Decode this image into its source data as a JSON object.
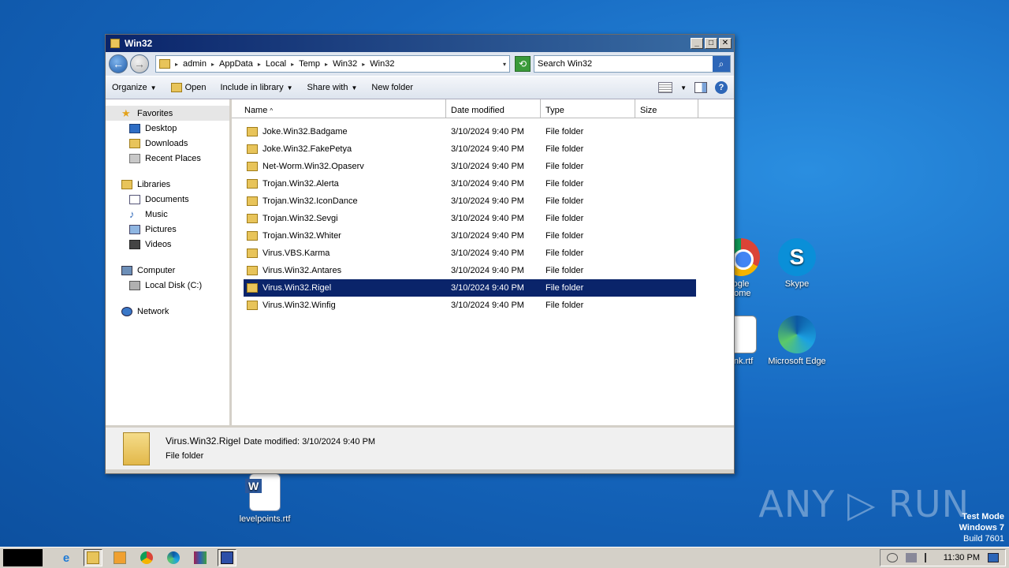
{
  "window": {
    "title": "Win32",
    "buttons": [
      "_",
      "□",
      "✕"
    ]
  },
  "address": {
    "crumbs": [
      "admin",
      "AppData",
      "Local",
      "Temp",
      "Win32",
      "Win32"
    ],
    "search_placeholder": "Search Win32"
  },
  "toolbar": {
    "organize": "Organize",
    "open": "Open",
    "include_in_library": "Include in library",
    "share_with": "Share with",
    "new_folder": "New folder"
  },
  "nav": {
    "favorites": "Favorites",
    "desktop": "Desktop",
    "downloads": "Downloads",
    "recent_places": "Recent Places",
    "libraries": "Libraries",
    "documents": "Documents",
    "music": "Music",
    "pictures": "Pictures",
    "videos": "Videos",
    "computer": "Computer",
    "local_disk": "Local Disk (C:)",
    "network": "Network"
  },
  "columns": {
    "name": "Name",
    "date": "Date modified",
    "type": "Type",
    "size": "Size"
  },
  "files": [
    {
      "name": "Joke.Win32.Badgame",
      "date": "3/10/2024 9:40 PM",
      "type": "File folder"
    },
    {
      "name": "Joke.Win32.FakePetya",
      "date": "3/10/2024 9:40 PM",
      "type": "File folder"
    },
    {
      "name": "Net-Worm.Win32.Opaserv",
      "date": "3/10/2024 9:40 PM",
      "type": "File folder"
    },
    {
      "name": "Trojan.Win32.Alerta",
      "date": "3/10/2024 9:40 PM",
      "type": "File folder"
    },
    {
      "name": "Trojan.Win32.IconDance",
      "date": "3/10/2024 9:40 PM",
      "type": "File folder"
    },
    {
      "name": "Trojan.Win32.Sevgi",
      "date": "3/10/2024 9:40 PM",
      "type": "File folder"
    },
    {
      "name": "Trojan.Win32.Whiter",
      "date": "3/10/2024 9:40 PM",
      "type": "File folder"
    },
    {
      "name": "Virus.VBS.Karma",
      "date": "3/10/2024 9:40 PM",
      "type": "File folder"
    },
    {
      "name": "Virus.Win32.Antares",
      "date": "3/10/2024 9:40 PM",
      "type": "File folder"
    },
    {
      "name": "Virus.Win32.Rigel",
      "date": "3/10/2024 9:40 PM",
      "type": "File folder"
    },
    {
      "name": "Virus.Win32.Winfig",
      "date": "3/10/2024 9:40 PM",
      "type": "File folder"
    }
  ],
  "selected_index": 9,
  "details": {
    "name": "Virus.Win32.Rigel",
    "meta": "Date modified: 3/10/2024 9:40 PM",
    "type": "File folder"
  },
  "desktop_icons": {
    "chrome": "ogle\nrome",
    "skype": "Skype",
    "rtf_partial": "ank.rtf",
    "edge": "Microsoft Edge",
    "levelpoints": "levelpoints.rtf"
  },
  "watermark": "ANY ▷ RUN",
  "testmode": {
    "line1": "Test Mode",
    "line2": "Windows 7",
    "line3": "Build 7601"
  },
  "taskbar": {
    "clock": "11:30 PM"
  },
  "icons": [
    "back-arrow-icon",
    "forward-arrow-icon",
    "folder-icon",
    "refresh-icon",
    "search-icon",
    "help-icon",
    "star-icon"
  ]
}
